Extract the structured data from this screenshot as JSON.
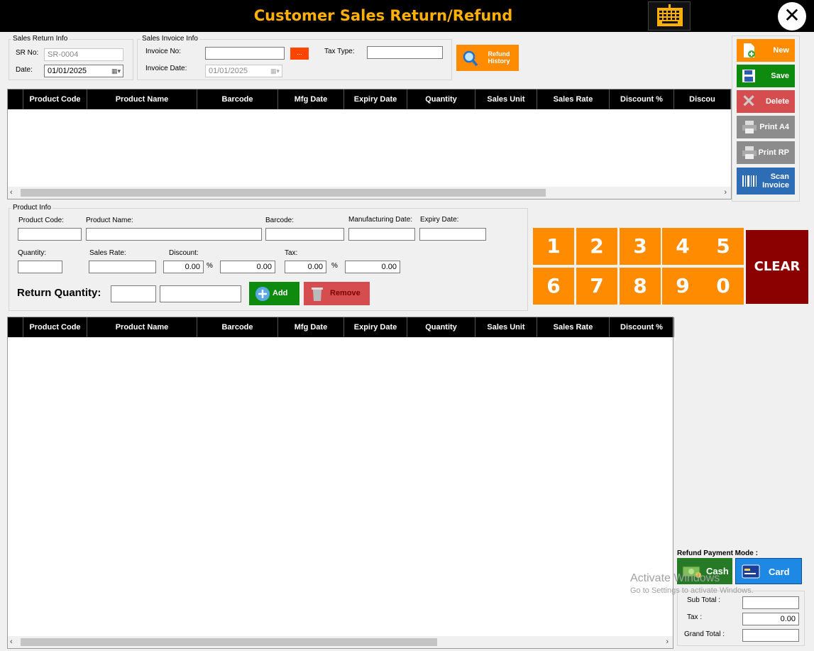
{
  "title": "Customer Sales Return/Refund",
  "colors": {
    "accent": "#ffb000",
    "orange": "#ff8c00",
    "green": "#0e8a0e",
    "red": "#c9262d",
    "blue": "#1e88e5",
    "clear": "#8b0000"
  },
  "sales_return_info": {
    "group_label": "Sales Return Info",
    "sr_no_label": "SR No:",
    "sr_no_value": "SR-0004",
    "date_label": "Date:",
    "date_value": "01/01/2025"
  },
  "sales_invoice_info": {
    "group_label": "Sales Invoice Info",
    "invoice_no_label": "Invoice No:",
    "invoice_no_value": "",
    "browse_label": "...",
    "tax_type_label": "Tax Type:",
    "tax_type_value": "",
    "invoice_date_label": "Invoice Date:",
    "invoice_date_value": "01/01/2025"
  },
  "refund_history_label": "Refund History",
  "actions": {
    "new": "New",
    "save": "Save",
    "delete": "Delete",
    "print_a4": "Print A4",
    "print_rp": "Print RP",
    "scan_invoice": "Scan Invoice"
  },
  "top_grid": {
    "columns": [
      "Product Code",
      "Product Name",
      "Barcode",
      "Mfg Date",
      "Expiry Date",
      "Quantity",
      "Sales Unit",
      "Sales Rate",
      "Discount %",
      "Discou"
    ]
  },
  "product_info": {
    "group_label": "Product Info",
    "product_code_label": "Product Code:",
    "product_name_label": "Product Name:",
    "barcode_label": "Barcode:",
    "mfg_date_label": "Manufacturing Date:",
    "expiry_date_label": "Expiry Date:",
    "quantity_label": "Quantity:",
    "sales_rate_label": "Sales Rate:",
    "discount_label": "Discount:",
    "discount_pct_value": "0.00",
    "percent_symbol": "%",
    "discount_amount_value": "0.00",
    "tax_label": "Tax:",
    "tax_pct_value": "0.00",
    "tax_amount_value": "0.00",
    "return_quantity_label": "Return Quantity:",
    "add_label": "Add",
    "remove_label": "Remove"
  },
  "numpad": {
    "keys": [
      "1",
      "2",
      "3",
      "4",
      "5",
      "6",
      "7",
      "8",
      "9",
      "0"
    ],
    "clear_label": "CLEAR"
  },
  "bottom_grid": {
    "columns": [
      "Product Code",
      "Product Name",
      "Barcode",
      "Mfg Date",
      "Expiry Date",
      "Quantity",
      "Sales Unit",
      "Sales Rate",
      "Discount %"
    ]
  },
  "refund_payment": {
    "label": "Refund Payment Mode :",
    "cash_label": "Cash",
    "card_label": "Card"
  },
  "totals": {
    "sub_total_label": "Sub Total :",
    "sub_total_value": "",
    "tax_label": "Tax :",
    "tax_value": "0.00",
    "grand_total_label": "Grand Total :",
    "grand_total_value": ""
  },
  "watermark": {
    "line1": "Activate Windows",
    "line2": "Go to Settings to activate Windows."
  },
  "icons": {
    "close": "close-icon",
    "keyboard": "keyboard-icon",
    "search": "search-icon",
    "calendar": "calendar-icon"
  }
}
